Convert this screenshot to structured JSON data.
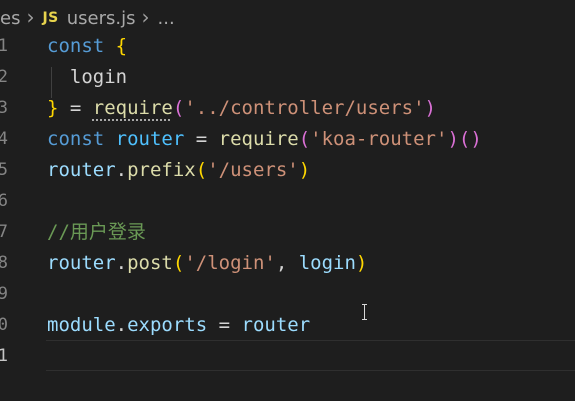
{
  "breadcrumb": {
    "folder": "es",
    "language_badge": "JS",
    "file": "users.js",
    "ellipsis": "..."
  },
  "editor": {
    "line_numbers": [
      "1",
      "2",
      "3",
      "4",
      "5",
      "6",
      "7",
      "8",
      "9",
      "0",
      "1"
    ],
    "active_line_index": 10,
    "lines": [
      [
        {
          "t": "const",
          "c": "kw"
        },
        {
          "t": " ",
          "c": "plain"
        },
        {
          "t": "{",
          "c": "brace"
        }
      ],
      [
        {
          "t": "  login",
          "c": "plain"
        }
      ],
      [
        {
          "t": "}",
          "c": "brace"
        },
        {
          "t": " = ",
          "c": "plain"
        },
        {
          "t": "require",
          "c": "fn dotted"
        },
        {
          "t": "(",
          "c": "paren"
        },
        {
          "t": "'../controller/users'",
          "c": "str"
        },
        {
          "t": ")",
          "c": "paren"
        }
      ],
      [
        {
          "t": "const",
          "c": "kw"
        },
        {
          "t": " ",
          "c": "plain"
        },
        {
          "t": "router",
          "c": "var"
        },
        {
          "t": " = ",
          "c": "plain"
        },
        {
          "t": "require",
          "c": "fn"
        },
        {
          "t": "(",
          "c": "paren"
        },
        {
          "t": "'koa-router'",
          "c": "str"
        },
        {
          "t": ")()",
          "c": "paren"
        }
      ],
      [
        {
          "t": "router",
          "c": "prop"
        },
        {
          "t": ".",
          "c": "plain"
        },
        {
          "t": "prefix",
          "c": "fn"
        },
        {
          "t": "(",
          "c": "brace"
        },
        {
          "t": "'/users'",
          "c": "str"
        },
        {
          "t": ")",
          "c": "brace"
        }
      ],
      [],
      [
        {
          "t": "//用户登录",
          "c": "cmt"
        }
      ],
      [
        {
          "t": "router",
          "c": "prop"
        },
        {
          "t": ".",
          "c": "plain"
        },
        {
          "t": "post",
          "c": "fn"
        },
        {
          "t": "(",
          "c": "brace"
        },
        {
          "t": "'/login'",
          "c": "str"
        },
        {
          "t": ", ",
          "c": "plain"
        },
        {
          "t": "login",
          "c": "prop"
        },
        {
          "t": ")",
          "c": "brace"
        }
      ],
      [],
      [
        {
          "t": "module",
          "c": "prop"
        },
        {
          "t": ".",
          "c": "plain"
        },
        {
          "t": "exports",
          "c": "prop"
        },
        {
          "t": " = ",
          "c": "plain"
        },
        {
          "t": "router",
          "c": "prop"
        }
      ],
      []
    ]
  },
  "colors": {
    "background": "#1e1e1e",
    "keyword": "#569cd6",
    "function": "#dcdcaa",
    "string": "#ce9178",
    "comment": "#6a9955",
    "bracket_gold": "#ffd700",
    "bracket_purple": "#da70d6",
    "js_badge": "#e8d44d"
  }
}
